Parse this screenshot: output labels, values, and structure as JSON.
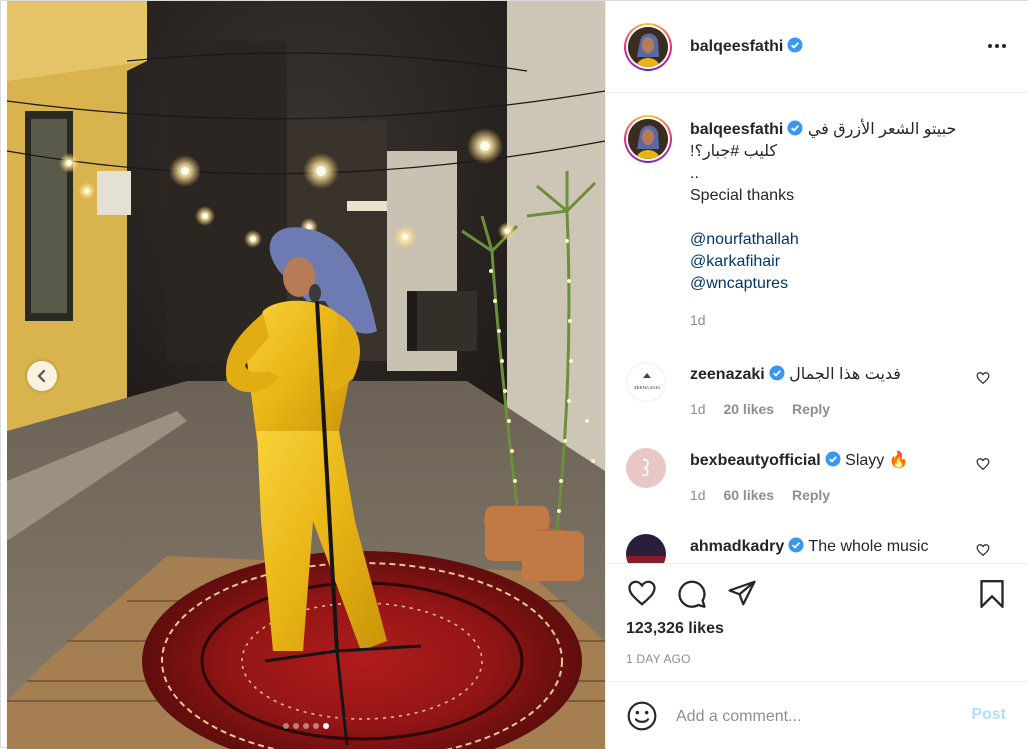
{
  "post": {
    "username": "balqeesfathi",
    "verified": true,
    "caption": {
      "line1": "حبيتو الشعر الأزرق في",
      "line2": "كليب #جبار؟!",
      "line3": "..",
      "line4": "Special thanks",
      "mentions": [
        "@nourfathallah",
        "@karkafihair",
        "@wncaptures"
      ],
      "time": "1d"
    },
    "likes": "123,326 likes",
    "date": "1 DAY AGO",
    "carousel": {
      "count": 5,
      "active": 4
    }
  },
  "comments": [
    {
      "username": "zeenazaki",
      "verified": true,
      "text": "فديت هذا الجمال",
      "time": "1d",
      "likes": "20 likes",
      "reply": "Reply",
      "avatar_label": "ZEENA ZAKI"
    },
    {
      "username": "bexbeautyofficial",
      "verified": true,
      "text": "Slayy 🔥",
      "time": "1d",
      "likes": "60 likes",
      "reply": "Reply"
    },
    {
      "username": "ahmadkadry",
      "verified": true,
      "text": "The whole music"
    }
  ],
  "comment_box": {
    "placeholder": "Add a comment...",
    "post_label": "Post"
  },
  "colors": {
    "verified": "#3897f0",
    "link": "#00376b",
    "post_disabled": "#b2dffc",
    "muted": "#8e8e8e"
  },
  "icons": [
    "chevron-left-icon",
    "more-icon",
    "heart-icon",
    "comment-icon",
    "share-icon",
    "bookmark-icon",
    "emoji-icon",
    "verified-icon"
  ]
}
